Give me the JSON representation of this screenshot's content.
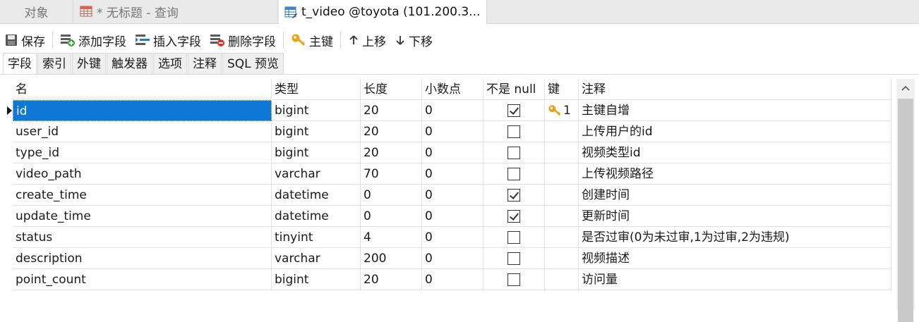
{
  "doc_tabs": [
    {
      "label": "对象"
    },
    {
      "label": "* 无标题 - 查询"
    },
    {
      "label": "t_video @toyota (101.200.3..."
    }
  ],
  "toolbar": {
    "save": "保存",
    "add_field": "添加字段",
    "insert_field": "插入字段",
    "delete_field": "删除字段",
    "primary_key": "主键",
    "move_up": "上移",
    "move_down": "下移"
  },
  "subtabs": [
    "字段",
    "索引",
    "外键",
    "触发器",
    "选项",
    "注释",
    "SQL 预览"
  ],
  "grid": {
    "headers": {
      "name": "名",
      "type": "类型",
      "length": "长度",
      "decimals": "小数点",
      "not_null": "不是 null",
      "key": "键",
      "comment": "注释"
    },
    "rows": [
      {
        "name": "id",
        "type": "bigint",
        "length": "20",
        "decimals": "0",
        "not_null": true,
        "key": "1",
        "comment": "主键自增"
      },
      {
        "name": "user_id",
        "type": "bigint",
        "length": "20",
        "decimals": "0",
        "not_null": false,
        "key": "",
        "comment": "上传用户的id"
      },
      {
        "name": "type_id",
        "type": "bigint",
        "length": "20",
        "decimals": "0",
        "not_null": false,
        "key": "",
        "comment": "视频类型id"
      },
      {
        "name": "video_path",
        "type": "varchar",
        "length": "70",
        "decimals": "0",
        "not_null": false,
        "key": "",
        "comment": "上传视频路径"
      },
      {
        "name": "create_time",
        "type": "datetime",
        "length": "0",
        "decimals": "0",
        "not_null": true,
        "key": "",
        "comment": "创建时间"
      },
      {
        "name": "update_time",
        "type": "datetime",
        "length": "0",
        "decimals": "0",
        "not_null": true,
        "key": "",
        "comment": "更新时间"
      },
      {
        "name": "status",
        "type": "tinyint",
        "length": "4",
        "decimals": "0",
        "not_null": false,
        "key": "",
        "comment": "是否过审(0为未过审,1为过审,2为违规)"
      },
      {
        "name": "description",
        "type": "varchar",
        "length": "200",
        "decimals": "0",
        "not_null": false,
        "key": "",
        "comment": "视频描述"
      },
      {
        "name": "point_count",
        "type": "bigint",
        "length": "20",
        "decimals": "0",
        "not_null": false,
        "key": "",
        "comment": "访问量"
      }
    ]
  },
  "colors": {
    "selection": "#0f78d7",
    "key_icon": "#e8a317"
  },
  "icons": {
    "table": "table-icon",
    "save": "save-icon",
    "key": "key-icon"
  }
}
